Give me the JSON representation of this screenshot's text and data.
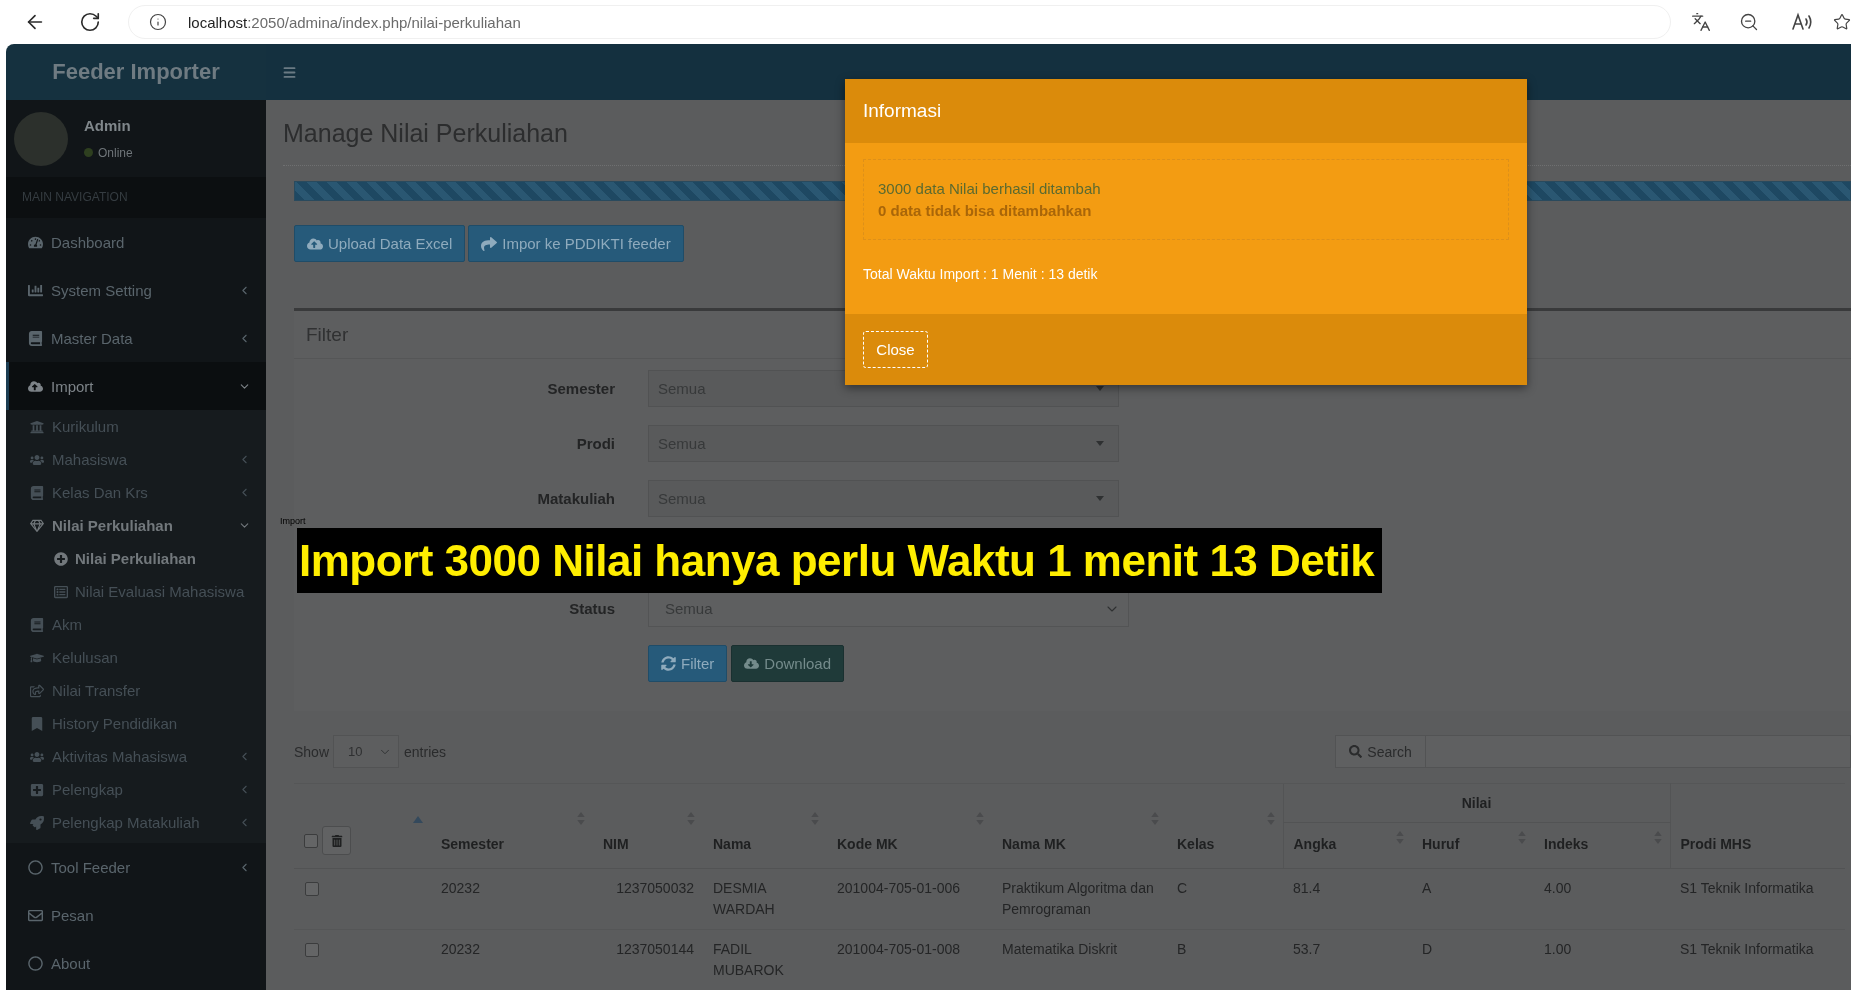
{
  "browser": {
    "url": {
      "host": "localhost",
      "path": ":2050/admina/index.php/nilai-perkuliahan"
    }
  },
  "app": {
    "title": "Feeder Importer"
  },
  "user": {
    "name": "Admin",
    "status": "Online"
  },
  "sidebar": {
    "header": "MAIN NAVIGATION",
    "items": [
      {
        "label": "Dashboard",
        "selected": false
      },
      {
        "label": "System Setting",
        "selected": false,
        "expanded": false
      },
      {
        "label": "Master Data",
        "selected": false,
        "expanded": false
      },
      {
        "label": "Import",
        "selected": true,
        "expanded": true,
        "children": [
          {
            "label": "Kurikulum",
            "selected": false
          },
          {
            "label": "Mahasiswa",
            "selected": false,
            "expanded": false
          },
          {
            "label": "Kelas Dan Krs",
            "selected": false,
            "expanded": false
          },
          {
            "label": "Nilai Perkuliahan",
            "selected": true,
            "expanded": true,
            "children": [
              {
                "label": "Nilai Perkuliahan",
                "selected": true
              },
              {
                "label": "Nilai Evaluasi Mahasiswa",
                "selected": false
              }
            ]
          },
          {
            "label": "Akm",
            "selected": false
          },
          {
            "label": "Kelulusan",
            "selected": false
          },
          {
            "label": "Nilai Transfer",
            "selected": false
          },
          {
            "label": "History Pendidikan",
            "selected": false
          },
          {
            "label": "Aktivitas Mahasiswa",
            "selected": false,
            "expanded": false
          },
          {
            "label": "Pelengkap",
            "selected": false,
            "expanded": false
          },
          {
            "label": "Pelengkap Matakuliah",
            "selected": false,
            "expanded": false
          }
        ]
      },
      {
        "label": "Tool Feeder",
        "selected": false,
        "expanded": false
      },
      {
        "label": "Pesan",
        "selected": false
      },
      {
        "label": "About",
        "selected": false
      }
    ]
  },
  "page": {
    "title": "Manage Nilai Perkuliahan",
    "progress": {
      "level": 1
    },
    "actions": [
      {
        "label": "Upload Data Excel",
        "kind": "primary"
      },
      {
        "label": "Impor ke PDDIKTI feeder",
        "kind": "primary"
      }
    ]
  },
  "filter": {
    "title": "Filter",
    "fields": [
      {
        "label": "Semester",
        "kind": "searchable",
        "value": "Semua"
      },
      {
        "label": "Prodi",
        "kind": "searchable",
        "value": "Semua"
      },
      {
        "label": "Matakuliah",
        "kind": "searchable",
        "value": "Semua"
      },
      {
        "label": "Status",
        "kind": "native",
        "value": "Semua"
      }
    ],
    "buttons": [
      {
        "label": "Filter",
        "kind": "primary"
      },
      {
        "label": "Download",
        "kind": "success"
      }
    ]
  },
  "table_controls": {
    "show_label": "Show",
    "page_size": "10",
    "entries_label": "entries",
    "search_button": "Search"
  },
  "table": {
    "select_column": {
      "checked": false,
      "sorted": true
    },
    "column_group": {
      "label": "Nilai"
    },
    "columns": [
      {
        "label": "Semester",
        "sorted": false
      },
      {
        "label": "NIM",
        "sorted": false
      },
      {
        "label": "Nama",
        "sorted": false
      },
      {
        "label": "Kode MK",
        "sorted": false
      },
      {
        "label": "Nama MK",
        "sorted": false
      },
      {
        "label": "Kelas",
        "sorted": false
      },
      {
        "label": "Angka",
        "sorted": false,
        "grouped": true
      },
      {
        "label": "Huruf",
        "sorted": false,
        "grouped": true
      },
      {
        "label": "Indeks",
        "sorted": false,
        "grouped": true
      },
      {
        "label": "Prodi MHS"
      }
    ],
    "rows": [
      {
        "checked": false,
        "cells": [
          "20232",
          "1237050032",
          "DESMIA WARDAH",
          "201004-705-01-006",
          "Praktikum Algoritma dan Pemrograman",
          "C",
          "81.4",
          "A",
          "4.00",
          "S1 Teknik Informatika"
        ]
      },
      {
        "checked": false,
        "cells": [
          "20232",
          "1237050144",
          "FADIL MUBAROK",
          "201004-705-01-008",
          "Matematika Diskrit",
          "B",
          "53.7",
          "D",
          "1.00",
          "S1 Teknik Informatika"
        ]
      }
    ]
  },
  "tooltip": {
    "text": "Import"
  },
  "caption": {
    "text": "Import 3000 Nilai hanya perlu Waktu 1 menit 13 Detik"
  },
  "modal": {
    "title": "Informasi",
    "success": "3000 data Nilai berhasil ditambah",
    "failed": "0 data tidak bisa ditambahkan",
    "total": "Total Waktu Import : 1 Menit : 13 detik",
    "close": "Close"
  }
}
